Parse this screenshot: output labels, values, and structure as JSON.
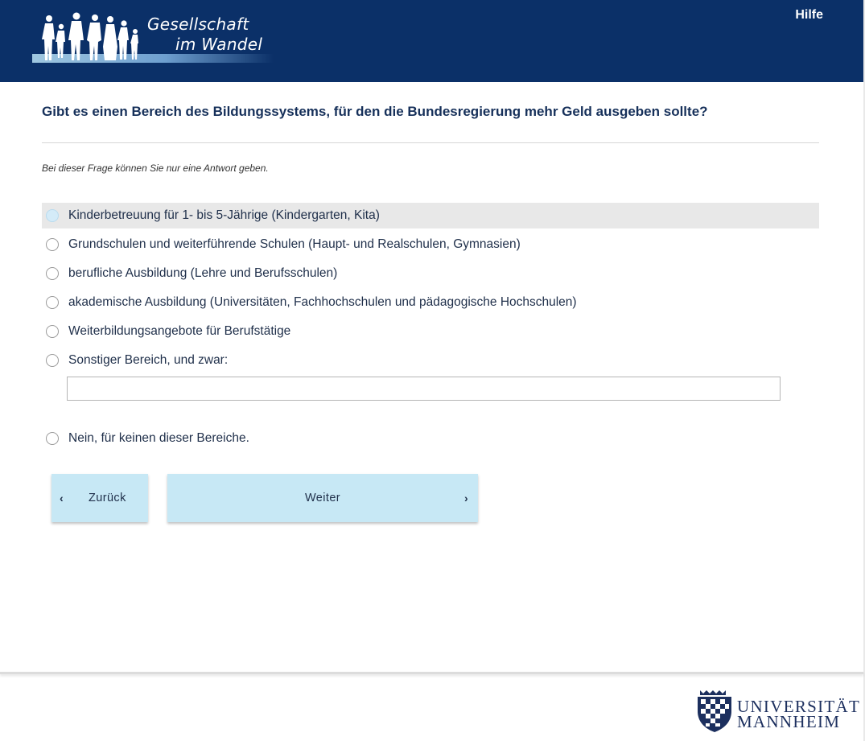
{
  "header": {
    "logo_line1": "Gesellschaft",
    "logo_line2": "im Wandel",
    "help_link": "Hilfe"
  },
  "question": {
    "title": "Gibt es einen Bereich des Bildungssystems, für den die Bundesregierung mehr Geld ausgeben sollte?",
    "hint": "Bei dieser Frage können Sie nur eine Antwort geben."
  },
  "options": [
    {
      "label": "Kinderbetreuung für 1- bis 5-Jährige (Kindergarten, Kita)",
      "highlighted": true
    },
    {
      "label": "Grundschulen und weiterführende Schulen (Haupt- und Realschulen, Gymnasien)"
    },
    {
      "label": "berufliche Ausbildung (Lehre und Berufsschulen)"
    },
    {
      "label": "akademische Ausbildung (Universitäten, Fachhochschulen und pädagogische Hochschulen)"
    },
    {
      "label": "Weiterbildungsangebote für Berufstätige"
    },
    {
      "label": "Sonstiger Bereich, und zwar:"
    },
    {
      "label": "Nein, für keinen dieser Bereiche."
    }
  ],
  "other_input": {
    "value": "",
    "placeholder": ""
  },
  "buttons": {
    "back": "Zurück",
    "next": "Weiter",
    "back_icon": "‹",
    "next_icon": "›"
  },
  "footer": {
    "university_line1": "UNIVERSITÄT",
    "university_line2": "MANNHEIM"
  },
  "colors": {
    "header_bg": "#0b3068",
    "button_bg": "#c7e8f5",
    "highlight_bg": "#e8e8e8",
    "text": "#1f2f4a"
  }
}
